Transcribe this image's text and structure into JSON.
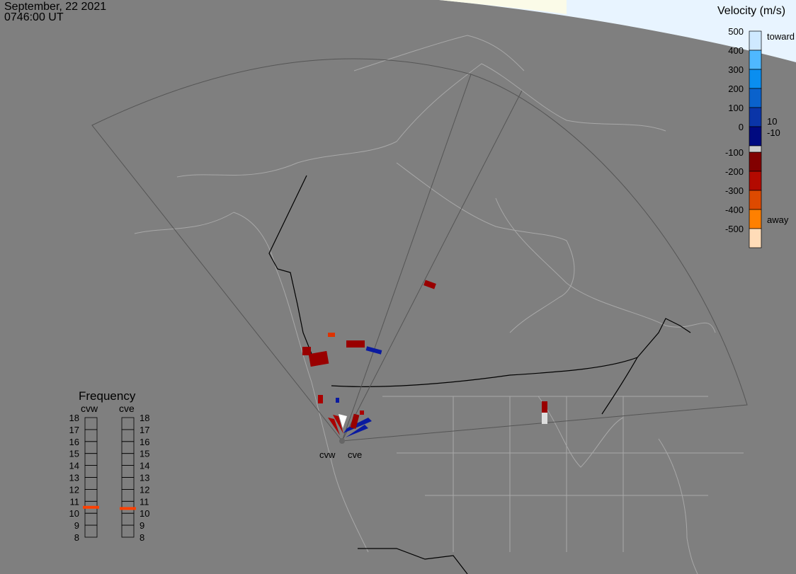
{
  "header": {
    "date": "September, 22 2021",
    "time": "0746:00 UT"
  },
  "colorbar": {
    "title": "Velocity (m/s)",
    "ticks": [
      "500",
      "400",
      "300",
      "200",
      "100",
      "0",
      "-100",
      "-200",
      "-300",
      "-400",
      "-500"
    ],
    "inner_labels": [
      "10",
      "-10"
    ],
    "toward_label": "toward",
    "away_label": "away",
    "colors": [
      "#cfe9ff",
      "#4fb8ff",
      "#0a8ef0",
      "#0a62cc",
      "#0a35a8",
      "#000a80",
      "#820000",
      "#b30a00",
      "#dd4a00",
      "#ff8000",
      "#ffdcb8"
    ]
  },
  "frequency": {
    "title": "Frequency",
    "radars": [
      {
        "name": "cvw",
        "value_mhz": 10.5
      },
      {
        "name": "cve",
        "value_mhz": 10.4
      }
    ],
    "scale": [
      "18",
      "17",
      "16",
      "15",
      "14",
      "13",
      "12",
      "11",
      "10",
      "9",
      "8"
    ],
    "marker_color": "#ff4000"
  },
  "radar_labels": [
    "cvw",
    "cve"
  ]
}
